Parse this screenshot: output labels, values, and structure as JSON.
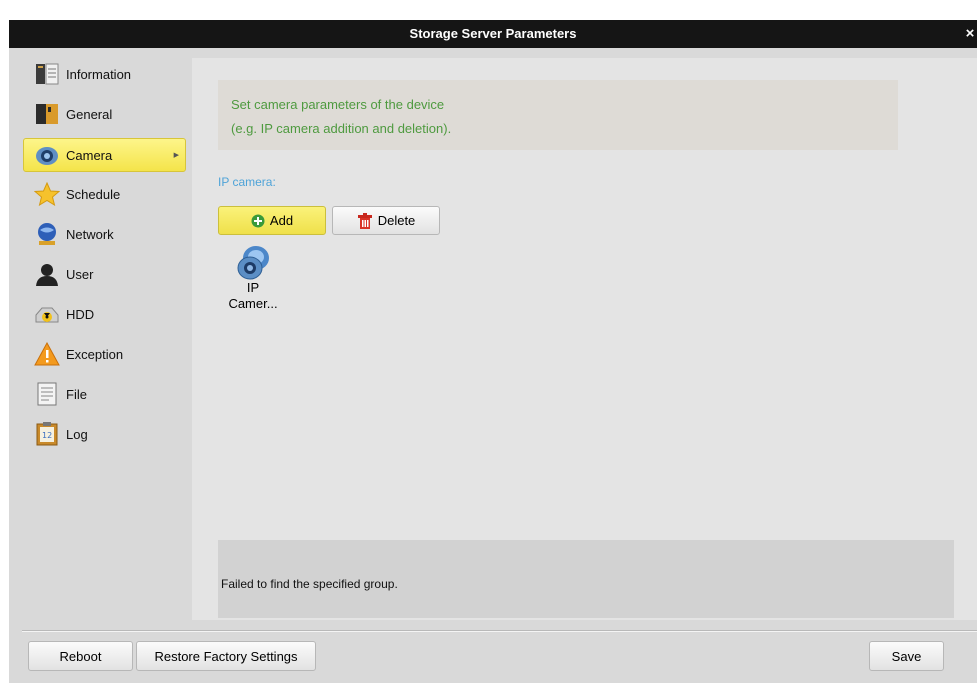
{
  "window": {
    "title": "Storage Server Parameters",
    "close_glyph": "×"
  },
  "sidebar": {
    "items": [
      {
        "label": "Information",
        "icon": "information-icon"
      },
      {
        "label": "General",
        "icon": "general-icon"
      },
      {
        "label": "Camera",
        "icon": "camera-icon",
        "active": true
      },
      {
        "label": "Schedule",
        "icon": "schedule-star-icon"
      },
      {
        "label": "Network",
        "icon": "network-icon"
      },
      {
        "label": "User",
        "icon": "user-icon"
      },
      {
        "label": "HDD",
        "icon": "hdd-icon"
      },
      {
        "label": "Exception",
        "icon": "exception-warning-icon"
      },
      {
        "label": "File",
        "icon": "file-icon"
      },
      {
        "label": "Log",
        "icon": "log-icon"
      }
    ]
  },
  "content": {
    "hint_line1": "Set camera parameters of the device",
    "hint_line2": "(e.g. IP camera addition and deletion).",
    "section_label": "IP camera:",
    "add_label": "Add",
    "delete_label": "Delete",
    "camera_tile_line1": "IP",
    "camera_tile_line2": "Camer...",
    "status_text": "Failed to find the specified group."
  },
  "footer": {
    "reboot_label": "Reboot",
    "restore_label": "Restore Factory Settings",
    "save_label": "Save"
  },
  "colors": {
    "titlebar": "#151515",
    "hint_text": "#4e9a3f",
    "section_label": "#4ea3d8",
    "active_item": "#f4e44a"
  }
}
